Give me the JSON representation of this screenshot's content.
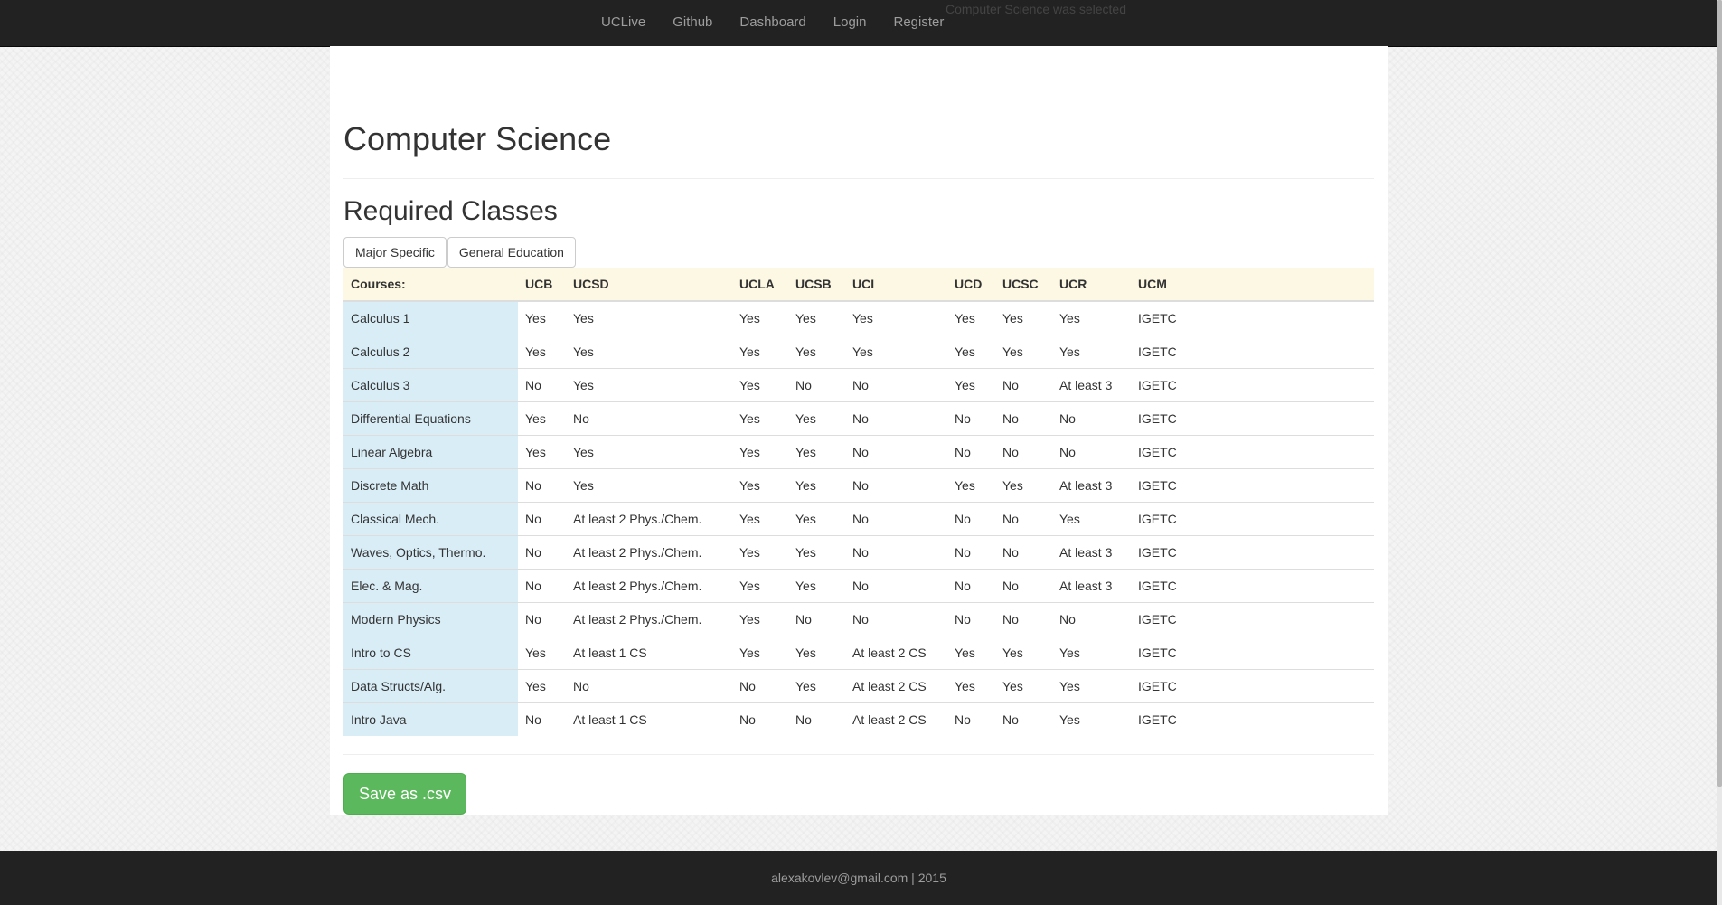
{
  "nav": {
    "links": [
      "UCLive",
      "Github",
      "Dashboard",
      "Login",
      "Register"
    ]
  },
  "toast": "Computer Science was selected",
  "page": {
    "title": "Computer Science",
    "section_title": "Required Classes",
    "tabs": [
      "Major Specific",
      "General Education"
    ]
  },
  "table": {
    "headers": [
      "Courses:",
      "UCB",
      "UCSD",
      "UCLA",
      "UCSB",
      "UCI",
      "UCD",
      "UCSC",
      "UCR",
      "UCM"
    ],
    "rows": [
      [
        "Calculus 1",
        "Yes",
        "Yes",
        "Yes",
        "Yes",
        "Yes",
        "Yes",
        "Yes",
        "Yes",
        "IGETC"
      ],
      [
        "Calculus 2",
        "Yes",
        "Yes",
        "Yes",
        "Yes",
        "Yes",
        "Yes",
        "Yes",
        "Yes",
        "IGETC"
      ],
      [
        "Calculus 3",
        "No",
        "Yes",
        "Yes",
        "No",
        "No",
        "Yes",
        "No",
        "At least 3",
        "IGETC"
      ],
      [
        "Differential Equations",
        "Yes",
        "No",
        "Yes",
        "Yes",
        "No",
        "No",
        "No",
        "No",
        "IGETC"
      ],
      [
        "Linear Algebra",
        "Yes",
        "Yes",
        "Yes",
        "Yes",
        "No",
        "No",
        "No",
        "No",
        "IGETC"
      ],
      [
        "Discrete Math",
        "No",
        "Yes",
        "Yes",
        "Yes",
        "No",
        "Yes",
        "Yes",
        "At least 3",
        "IGETC"
      ],
      [
        "Classical Mech.",
        "No",
        "At least 2 Phys./Chem.",
        "Yes",
        "Yes",
        "No",
        "No",
        "No",
        "Yes",
        "IGETC"
      ],
      [
        "Waves, Optics, Thermo.",
        "No",
        "At least 2 Phys./Chem.",
        "Yes",
        "Yes",
        "No",
        "No",
        "No",
        "At least 3",
        "IGETC"
      ],
      [
        "Elec. & Mag.",
        "No",
        "At least 2 Phys./Chem.",
        "Yes",
        "Yes",
        "No",
        "No",
        "No",
        "At least 3",
        "IGETC"
      ],
      [
        "Modern Physics",
        "No",
        "At least 2 Phys./Chem.",
        "Yes",
        "No",
        "No",
        "No",
        "No",
        "No",
        "IGETC"
      ],
      [
        "Intro to CS",
        "Yes",
        "At least 1 CS",
        "Yes",
        "Yes",
        "At least 2 CS",
        "Yes",
        "Yes",
        "Yes",
        "IGETC"
      ],
      [
        "Data Structs/Alg.",
        "Yes",
        "No",
        "No",
        "Yes",
        "At least 2 CS",
        "Yes",
        "Yes",
        "Yes",
        "IGETC"
      ],
      [
        "Intro Java",
        "No",
        "At least 1 CS",
        "No",
        "No",
        "At least 2 CS",
        "No",
        "No",
        "Yes",
        "IGETC"
      ]
    ]
  },
  "actions": {
    "save_label": "Save as .csv"
  },
  "footer": {
    "text": "alexakovlev@gmail.com | 2015"
  },
  "colors": {
    "navbar": "#222222",
    "header_row": "#fcf8e3",
    "course_cell": "#d9edf7",
    "save_button": "#5cb85c"
  }
}
